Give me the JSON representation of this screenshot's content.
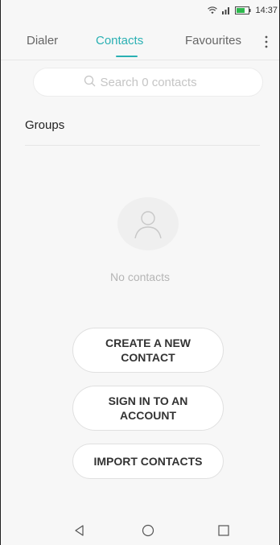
{
  "status_bar": {
    "time": "14:37",
    "icons": [
      "wifi-icon",
      "signal-icon",
      "battery-icon"
    ],
    "battery_color": "#2db84d"
  },
  "tabs": [
    {
      "label": "Dialer",
      "active": false
    },
    {
      "label": "Contacts",
      "active": true
    },
    {
      "label": "Favourites",
      "active": false
    }
  ],
  "accent_color": "#2ab0b3",
  "search": {
    "placeholder": "Search 0 contacts"
  },
  "groups_label": "Groups",
  "empty_state": {
    "text": "No contacts",
    "icon": "person-icon"
  },
  "actions": {
    "create": "CREATE A NEW CONTACT",
    "signin": "SIGN IN TO AN ACCOUNT",
    "import": "IMPORT CONTACTS"
  },
  "nav_bar": {
    "icons": [
      "back-icon",
      "home-icon",
      "recent-apps-icon"
    ]
  }
}
